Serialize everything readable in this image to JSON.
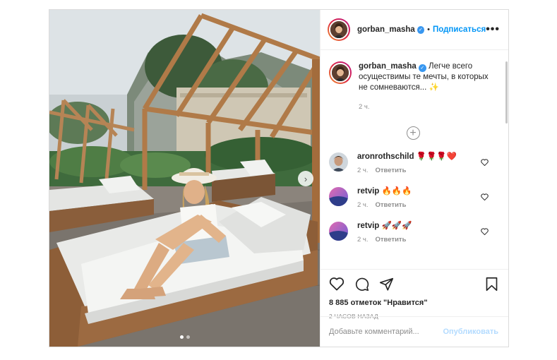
{
  "post": {
    "author": "gorban_masha",
    "header_separator": "•",
    "follow_label": "Подписаться",
    "more_label": "•••",
    "next_arrow": "›",
    "caption_text": "Легче всего осуществимы те мечты, в которых не сомневаются... ✨",
    "caption_time": "2 ч.",
    "load_more_symbol": "+",
    "likes": "8 885 отметок \"Нравится\"",
    "time_ago": "2 ЧАСОВ НАЗАД",
    "comment_placeholder": "Добавьте комментарий...",
    "publish_label": "Опубликовать",
    "verified_color": "#3897f0",
    "follow_color": "#0095f6"
  },
  "comments": [
    {
      "user": "aronrothschild",
      "text": "🌹🌹🌹❤️",
      "time": "2 ч.",
      "reply": "Ответить"
    },
    {
      "user": "retvip",
      "text": "🔥🔥🔥",
      "time": "2 ч.",
      "reply": "Ответить"
    },
    {
      "user": "retvip",
      "text": "🚀🚀🚀",
      "time": "2 ч.",
      "reply": "Ответить"
    }
  ],
  "carousel": {
    "slides": 2,
    "active_index": 0
  },
  "icons": [
    "verified-icon",
    "more-icon",
    "next-arrow-icon",
    "load-more-icon",
    "heart-icon",
    "comment-icon",
    "share-icon",
    "bookmark-icon"
  ]
}
